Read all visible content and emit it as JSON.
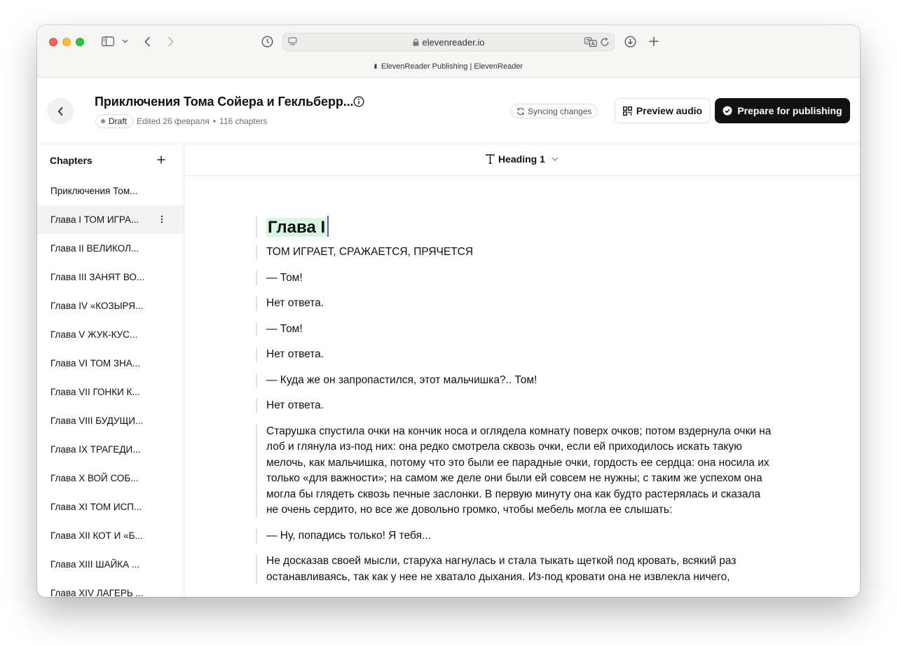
{
  "browser": {
    "url": "elevenreader.io",
    "tab_title": "ElevenReader Publishing | ElevenReader",
    "tab_favicon": "II"
  },
  "header": {
    "title": "Приключения Тома Сойера и Гекльберр...",
    "status_badge": "Draft",
    "edited": "Edited 26 февраля",
    "separator": "•",
    "chapters_count": "116 chapters",
    "sync_status": "Syncing changes",
    "preview_label": "Preview audio",
    "publish_label": "Prepare for publishing"
  },
  "sidebar": {
    "heading": "Chapters",
    "items": [
      {
        "label": "Приключения Том..."
      },
      {
        "label": "Глава I ТОМ ИГРА..."
      },
      {
        "label": "Глава II ВЕЛИКОЛ..."
      },
      {
        "label": "Глава III ЗАНЯТ ВО..."
      },
      {
        "label": "Глава IV «КОЗЫРЯ..."
      },
      {
        "label": "Глава V ЖУК-КУС..."
      },
      {
        "label": "Глава VI ТОМ ЗНА..."
      },
      {
        "label": "Глава VII ГОНКИ К..."
      },
      {
        "label": "Глава VIII БУДУЩИ..."
      },
      {
        "label": "Глава IX ТРАГЕДИ..."
      },
      {
        "label": "Глава X ВОЙ СОБ..."
      },
      {
        "label": "Глава XI ТОМ ИСП..."
      },
      {
        "label": "Глава XII КОТ И «Б..."
      },
      {
        "label": "Глава XIII ШАЙКА ..."
      },
      {
        "label": "Глава XIV ЛАГЕРЬ ..."
      }
    ],
    "active_index": 1
  },
  "toolbar": {
    "block_style": "Heading 1"
  },
  "editor": {
    "heading": "Глава I",
    "paragraphs": [
      "ТОМ ИГРАЕТ, СРАЖАЕТСЯ, ПРЯЧЕТСЯ",
      "— Том!",
      "Нет ответа.",
      "— Том!",
      "Нет ответа.",
      "— Куда же он запропастился, этот мальчишка?.. Том!",
      "Нет ответа.",
      "Старушка спустила очки на кончик носа и оглядела комнату поверх очков; потом вздернула очки на лоб и глянула из-под них: она редко смотрела сквозь очки, если ей приходилось искать такую мелочь, как мальчишка, потому что это были ее парадные очки, гордость ее сердца: она носила их только «для важности»; на самом же деле они были ей совсем не нужны; с таким же успехом она могла бы глядеть сквозь печные заслонки. В первую минуту она как будто растерялась и сказала не очень сердито, но все же довольно громко, чтобы мебель могла ее слышать:",
      "— Ну, попадись только! Я тебя...",
      "Не досказав своей мысли, старуха нагнулась и стала тыкать щеткой под кровать, всякий раз останавливаясь, так как у нее не хватало дыхания. Из-под кровати она не извлекла ничего,"
    ]
  },
  "colors": {
    "accent_dark": "#111111",
    "heading_highlight": "#d8f6e2",
    "caret": "#2f6bde"
  },
  "icons": [
    "back-icon",
    "info-icon",
    "sync-icon",
    "qr-icon",
    "check-circle-icon",
    "plus-icon",
    "kebab-icon",
    "text-type-icon",
    "chevron-down-icon"
  ]
}
